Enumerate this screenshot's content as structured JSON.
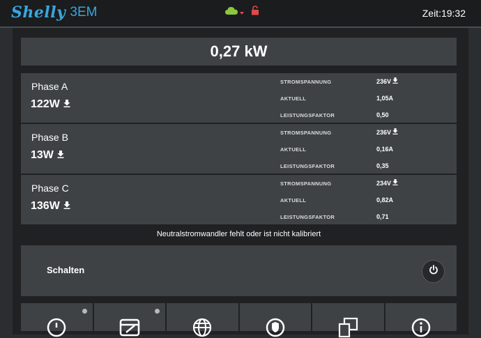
{
  "header": {
    "brand": "Shelly",
    "model": "3EM",
    "clock": "Zeit:19:32"
  },
  "total_power": "0,27 kW",
  "phases": [
    {
      "name": "Phase A",
      "power": "122W",
      "voltage_label": "STROMSPANNUNG",
      "voltage": "236V",
      "current_label": "AKTUELL",
      "current": "1,05A",
      "pf_label": "LEISTUNGSFAKTOR",
      "pf": "0,50"
    },
    {
      "name": "Phase B",
      "power": "13W",
      "voltage_label": "STROMSPANNUNG",
      "voltage": "236V",
      "current_label": "AKTUELL",
      "current": "0,16A",
      "pf_label": "LEISTUNGSFAKTOR",
      "pf": "0,35"
    },
    {
      "name": "Phase C",
      "power": "136W",
      "voltage_label": "STROMSPANNUNG",
      "voltage": "234V",
      "current_label": "AKTUELL",
      "current": "0,82A",
      "pf_label": "LEISTUNGSFAKTOR",
      "pf": "0,71"
    }
  ],
  "notice": "Neutralstromwandler fehlt oder ist nicht kalibriert",
  "switch": {
    "label": "Schalten"
  },
  "icons": {
    "cloud": "cloud-icon",
    "lock": "lock-icon",
    "download": "download-icon",
    "power": "power-icon"
  },
  "colors": {
    "brand": "#3aa6dd",
    "cloud": "#8dc63f",
    "lock": "#e04a4a",
    "panel": "#3e4245"
  }
}
